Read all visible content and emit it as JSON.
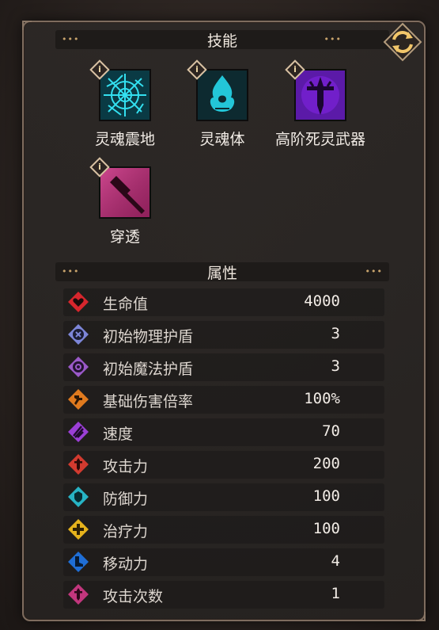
{
  "skills_section": {
    "title": "技能",
    "dots": "•••"
  },
  "skills": [
    {
      "name": "灵魂震地",
      "icon": "soul-quake-icon",
      "color": "#1fb7c9",
      "info": "i"
    },
    {
      "name": "灵魂体",
      "icon": "soul-body-icon",
      "color": "#23c6d8",
      "info": "i"
    },
    {
      "name": "高阶死灵武器",
      "icon": "necro-weapon-icon",
      "color": "#7a22d8",
      "info": "i"
    },
    {
      "name": "穿透",
      "icon": "pierce-icon",
      "color": "#c2367d",
      "info": "i"
    }
  ],
  "attrs_section": {
    "title": "属性",
    "dots": "•••"
  },
  "attributes": [
    {
      "label": "生命值",
      "value": "4000",
      "icon": "heart-icon",
      "color": "#d7262d"
    },
    {
      "label": "初始物理护盾",
      "value": "3",
      "icon": "physical-shield-icon",
      "color": "#7d86d8"
    },
    {
      "label": "初始魔法护盾",
      "value": "3",
      "icon": "magic-shield-icon",
      "color": "#9a59c8"
    },
    {
      "label": "基础伤害倍率",
      "value": "100%",
      "icon": "damage-rate-icon",
      "color": "#e07a1e"
    },
    {
      "label": "速度",
      "value": "70",
      "icon": "speed-icon",
      "color": "#9b3fd6"
    },
    {
      "label": "攻击力",
      "value": "200",
      "icon": "attack-icon",
      "color": "#d23a2f"
    },
    {
      "label": "防御力",
      "value": "100",
      "icon": "defense-icon",
      "color": "#27b3c4"
    },
    {
      "label": "治疗力",
      "value": "100",
      "icon": "heal-icon",
      "color": "#e5b21c"
    },
    {
      "label": "移动力",
      "value": "4",
      "icon": "move-icon",
      "color": "#1f6ed6"
    },
    {
      "label": "攻击次数",
      "value": "1",
      "icon": "attack-count-icon",
      "color": "#c2367d"
    }
  ]
}
